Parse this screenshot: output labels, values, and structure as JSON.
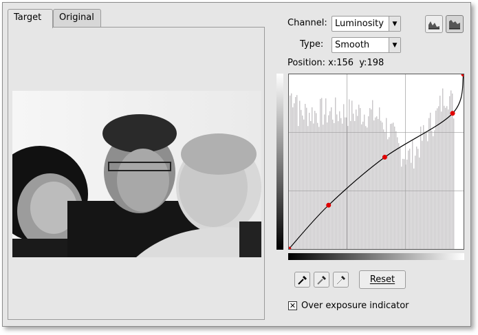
{
  "tabs": [
    {
      "label": "Target",
      "active": true
    },
    {
      "label": "Original",
      "active": false
    }
  ],
  "channel": {
    "label": "Channel:",
    "value": "Luminosity"
  },
  "type": {
    "label": "Type:",
    "value": "Smooth"
  },
  "position": {
    "label": "Position:",
    "x_label": "x:",
    "x": "156",
    "y_label": "y:",
    "y": "198"
  },
  "histogram_buttons": [
    {
      "icon": "linear-histogram-icon",
      "pressed": false
    },
    {
      "icon": "logarithmic-histogram-icon",
      "pressed": true
    }
  ],
  "curve": {
    "control_points": [
      [
        0,
        0
      ],
      [
        58,
        64
      ],
      [
        140,
        134
      ],
      [
        239,
        198
      ],
      [
        255,
        255
      ]
    ],
    "curve_color": "#000000",
    "point_color": "#e00000",
    "histogram_color": "#c8c5c8"
  },
  "pickers": [
    "black-point-picker-icon",
    "gray-point-picker-icon",
    "white-point-picker-icon"
  ],
  "reset_label": "Reset",
  "overexposure": {
    "label": "Over exposure indicator",
    "checked": true,
    "mark": "✕"
  }
}
